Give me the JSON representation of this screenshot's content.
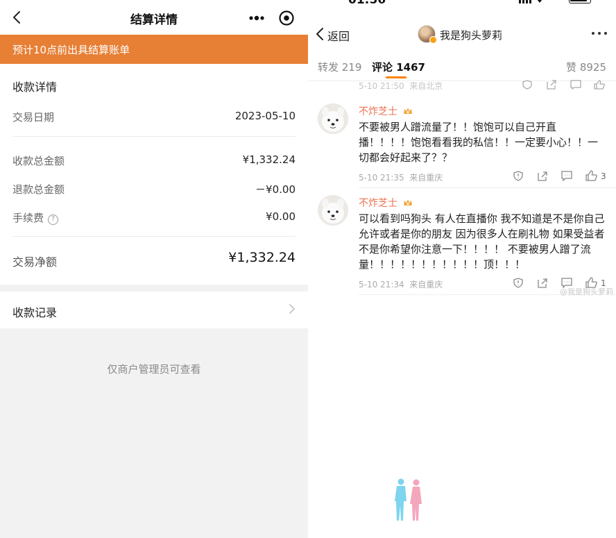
{
  "left": {
    "header": {
      "title": "结算详情"
    },
    "banner": {
      "text": "预计10点前出具结算账单"
    },
    "collection": {
      "title": "收款详情",
      "rows": [
        {
          "label": "交易日期",
          "value": "2023-05-10"
        },
        {
          "label": "收款总金额",
          "value": "¥1,332.24"
        },
        {
          "label": "退款总金额",
          "value": "－¥0.00"
        },
        {
          "label": "手续费",
          "value": "¥0.00"
        },
        {
          "label": "交易净额",
          "value": "¥1,332.24"
        }
      ]
    },
    "records": {
      "title": "收款记录"
    },
    "note": "仅商户管理员可查看"
  },
  "right": {
    "status": {
      "time": "01:56"
    },
    "nav": {
      "back_label": "返回",
      "username": "我是狗头萝莉"
    },
    "tabs": [
      {
        "label": "转发 219"
      },
      {
        "label": "评论 1467"
      },
      {
        "label": "赞 8925"
      }
    ],
    "prev_comment": {
      "time": "5-10 21:50",
      "location": "来自北京"
    },
    "comments": [
      {
        "name": "不炸芝士",
        "text": "不要被男人蹭流量了！！饱饱可以自己开直播！！！！饱饱看看我的私信！！一定要小心！！一切都会好起来了？？",
        "time": "5-10 21:35",
        "location": "来自重庆",
        "likes": "3"
      },
      {
        "name": "不炸芝士",
        "text": "可以看到吗狗头 有人在直播你 我不知道是不是你自己允许或者是你的朋友 因为很多人在刷礼物 如果受益者不是你希望你注意一下！！！！ 不要被男人蹭了流量！！！！！！！！！！！顶！！！",
        "time": "5-10 21:34",
        "location": "来自重庆",
        "likes": "1"
      }
    ],
    "watermark": "@我是狗头萝莉"
  }
}
